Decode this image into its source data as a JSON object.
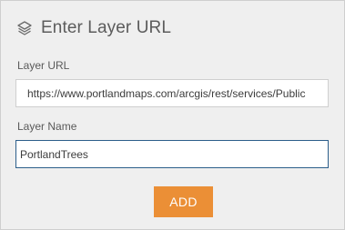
{
  "dialog": {
    "title": "Enter Layer URL",
    "icon": "layers-icon"
  },
  "form": {
    "url_label": "Layer URL",
    "url_value": "https://www.portlandmaps.com/arcgis/rest/services/Public",
    "name_label": "Layer Name",
    "name_value": "PortlandTrees",
    "add_label": "ADD"
  },
  "colors": {
    "panel_bg": "#efefef",
    "accent_button": "#eb8f36",
    "focus_border": "#2d5f8b"
  }
}
